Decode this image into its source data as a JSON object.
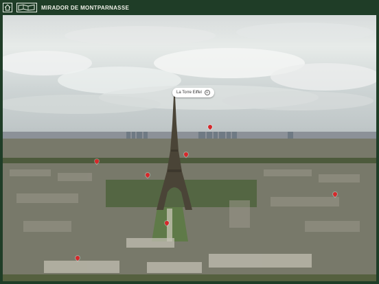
{
  "header": {
    "title": "MIRADOR DE MONTPARNASSE",
    "home_icon": "home-icon",
    "map_icon": "map-icon"
  },
  "colors": {
    "header_bg": "#1f3d27",
    "pin": "#d6282b"
  },
  "panorama": {
    "tooltip_label": "La Torre Eiffel",
    "tooltip_icon": "plus-circle-icon"
  }
}
